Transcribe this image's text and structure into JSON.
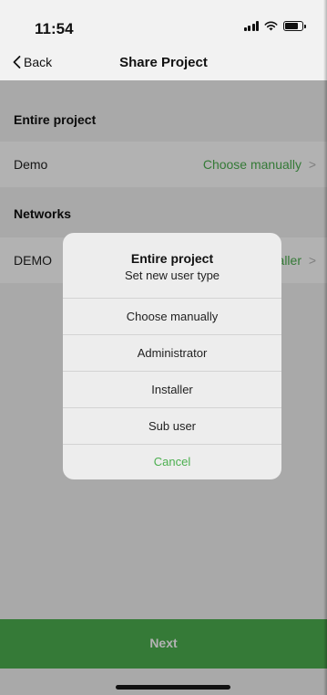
{
  "status_bar": {
    "time": "11:54",
    "signal_icon": "cellular-signal-icon",
    "wifi_icon": "wifi-icon",
    "battery_icon": "battery-icon"
  },
  "nav": {
    "back_label": "Back",
    "title": "Share Project"
  },
  "sections": [
    {
      "header": "Entire project",
      "row": {
        "label": "Demo",
        "value": "Choose manually"
      }
    },
    {
      "header": "Networks",
      "row": {
        "label": "DEMO",
        "value": "Installer"
      }
    }
  ],
  "footer": {
    "next_label": "Next"
  },
  "dialog": {
    "title": "Entire project",
    "subtitle": "Set new user type",
    "options": [
      "Choose manually",
      "Administrator",
      "Installer",
      "Sub user"
    ],
    "cancel_label": "Cancel"
  },
  "colors": {
    "accent": "#4caf50",
    "background": "#f2f2f2",
    "overlay": "rgba(0,0,0,0.30)"
  }
}
